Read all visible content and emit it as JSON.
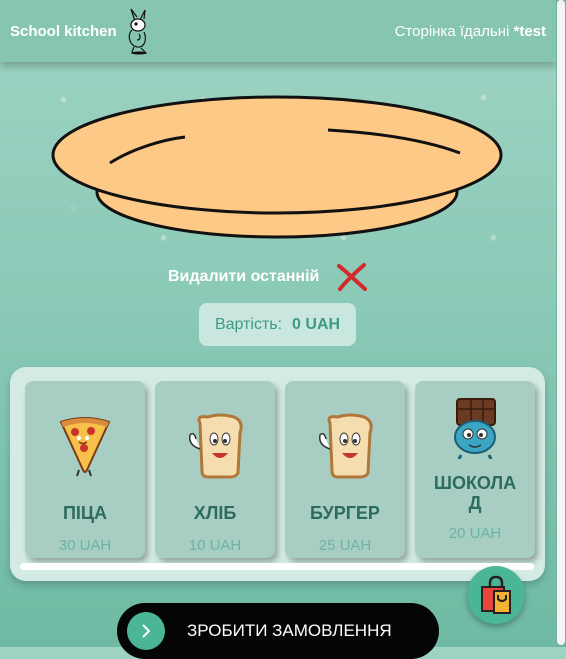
{
  "header": {
    "brand": "School kitchen",
    "page_label": "Сторінка їдальні",
    "user": "*test"
  },
  "plate": {
    "remove_last_label": "Видалити останній"
  },
  "cost": {
    "label": "Вартість:",
    "amount": "0 UAH"
  },
  "menu": {
    "items": [
      {
        "name": "ПІЦА",
        "price": "30 UAH",
        "icon": "pizza-icon"
      },
      {
        "name": "ХЛІБ",
        "price": "10 UAH",
        "icon": "bread-icon"
      },
      {
        "name": "БУРГЕР",
        "price": "25 UAH",
        "icon": "bread-icon"
      },
      {
        "name": "ШОКОЛАД",
        "name_line1": "ШОКОЛА",
        "name_line2": "Д",
        "price": "20 UAH",
        "icon": "chocolate-icon"
      }
    ]
  },
  "order": {
    "button_label": "ЗРОБИТИ ЗАМОВЛЕННЯ"
  },
  "colors": {
    "accent": "#4bb598",
    "background": "#8ccab8",
    "card": "#a8cec3",
    "text_dark": "#2d6b5f"
  }
}
